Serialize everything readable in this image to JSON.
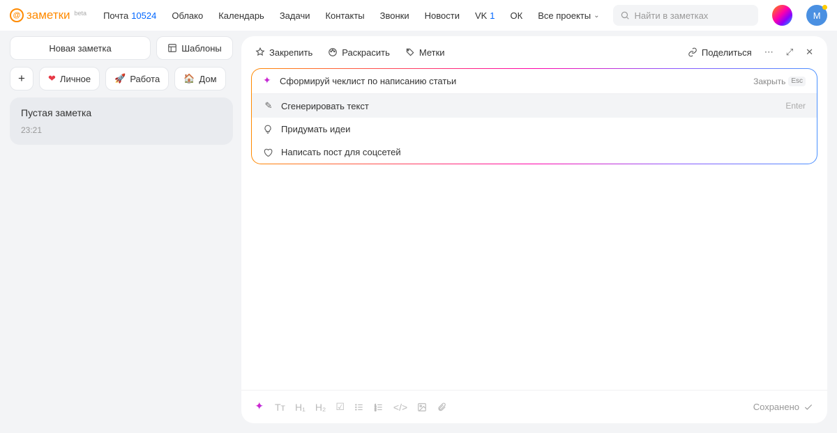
{
  "header": {
    "logo": "заметки",
    "beta": "beta",
    "nav": [
      {
        "label": "Почта",
        "count": "10524"
      },
      {
        "label": "Облако"
      },
      {
        "label": "Календарь"
      },
      {
        "label": "Задачи"
      },
      {
        "label": "Контакты"
      },
      {
        "label": "Звонки"
      },
      {
        "label": "Новости"
      },
      {
        "label": "VK",
        "count": "1"
      },
      {
        "label": "ОК"
      },
      {
        "label": "Все проекты",
        "dropdown": true
      }
    ],
    "search_placeholder": "Найти в заметках",
    "avatar_letter": "М"
  },
  "sidebar": {
    "new_note": "Новая заметка",
    "templates": "Шаблоны",
    "tags": [
      {
        "label": "Личное",
        "icon": "heart",
        "color": "#e63946"
      },
      {
        "label": "Работа",
        "icon": "rocket"
      },
      {
        "label": "Дом",
        "icon": "home"
      }
    ],
    "note": {
      "title": "Пустая заметка",
      "time": "23:21"
    }
  },
  "editor": {
    "actions": {
      "pin": "Закрепить",
      "color": "Раскрасить",
      "tags": "Метки",
      "share": "Поделиться"
    },
    "ai": {
      "input": "Сформируй чеклист по написанию статьи",
      "close": "Закрыть",
      "close_key": "Esc",
      "options": [
        {
          "label": "Сгенерировать текст",
          "hint": "Enter"
        },
        {
          "label": "Придумать идеи"
        },
        {
          "label": "Написать пост для соцсетей"
        }
      ]
    },
    "saved": "Сохранено"
  }
}
